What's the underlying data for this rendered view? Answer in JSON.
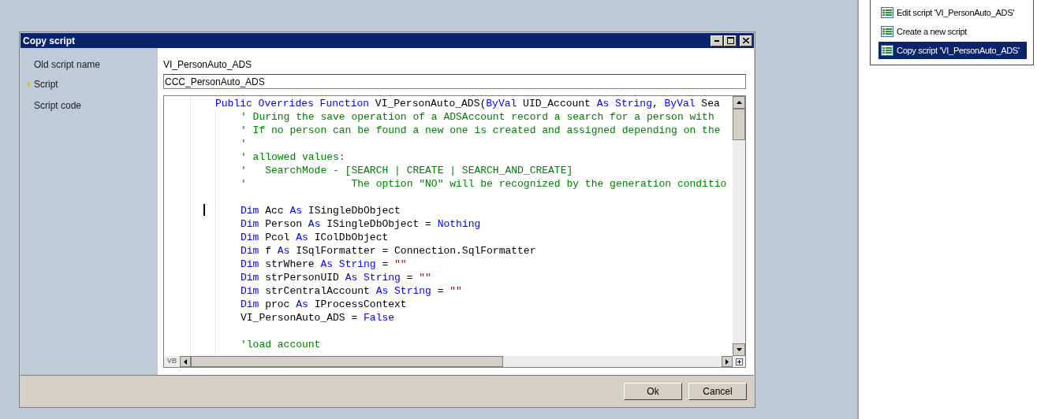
{
  "dialog": {
    "title": "Copy script",
    "fields": [
      {
        "label": "Old script name",
        "selected": false,
        "kind": "text",
        "value": "VI_PersonAuto_ADS"
      },
      {
        "label": "Script",
        "selected": true,
        "kind": "input",
        "value": "CCC_PersonAuto_ADS"
      },
      {
        "label": "Script code",
        "selected": false,
        "kind": "code"
      }
    ],
    "code": {
      "language": "VB",
      "lines": [
        {
          "kind": "signature",
          "tokens": [
            {
              "text": "Public Overrides Function",
              "kind": "keyword"
            },
            {
              "text": " VI_PersonAuto_ADS(",
              "kind": "plain"
            },
            {
              "text": "ByVal",
              "kind": "keyword"
            },
            {
              "text": " UID_Account ",
              "kind": "plain"
            },
            {
              "text": "As String",
              "kind": "keyword"
            },
            {
              "text": ", ",
              "kind": "plain"
            },
            {
              "text": "ByVal",
              "kind": "keyword"
            },
            {
              "text": " Sea",
              "kind": "plain"
            }
          ]
        },
        {
          "kind": "body",
          "tokens": [
            {
              "text": "' During the save operation of a ADSAccount record a search for a person with",
              "kind": "comment"
            }
          ]
        },
        {
          "kind": "body",
          "tokens": [
            {
              "text": "' If no person can be found a new one is created and assigned depending on the",
              "kind": "comment"
            }
          ]
        },
        {
          "kind": "body",
          "tokens": [
            {
              "text": "'",
              "kind": "comment"
            }
          ]
        },
        {
          "kind": "body",
          "tokens": [
            {
              "text": "' allowed values:",
              "kind": "comment"
            }
          ]
        },
        {
          "kind": "body",
          "tokens": [
            {
              "text": "'   SearchMode - [SEARCH | CREATE | SEARCH_AND_CREATE]",
              "kind": "comment"
            }
          ]
        },
        {
          "kind": "body",
          "tokens": [
            {
              "text": "'                 The option \"NO\" will be recognized by the generation conditio",
              "kind": "comment"
            }
          ]
        },
        {
          "kind": "blank"
        },
        {
          "kind": "body",
          "tokens": [
            {
              "text": "Dim",
              "kind": "keyword"
            },
            {
              "text": " Acc ",
              "kind": "plain"
            },
            {
              "text": "As",
              "kind": "keyword"
            },
            {
              "text": " ISingleDbObject",
              "kind": "plain"
            }
          ]
        },
        {
          "kind": "body",
          "tokens": [
            {
              "text": "Dim",
              "kind": "keyword"
            },
            {
              "text": " Person ",
              "kind": "plain"
            },
            {
              "text": "As",
              "kind": "keyword"
            },
            {
              "text": " ISingleDbObject = ",
              "kind": "plain"
            },
            {
              "text": "Nothing",
              "kind": "keyword"
            }
          ]
        },
        {
          "kind": "body",
          "tokens": [
            {
              "text": "Dim",
              "kind": "keyword"
            },
            {
              "text": " Pcol ",
              "kind": "plain"
            },
            {
              "text": "As",
              "kind": "keyword"
            },
            {
              "text": " IColDbObject",
              "kind": "plain"
            }
          ]
        },
        {
          "kind": "body",
          "tokens": [
            {
              "text": "Dim",
              "kind": "keyword"
            },
            {
              "text": " f ",
              "kind": "plain"
            },
            {
              "text": "As",
              "kind": "keyword"
            },
            {
              "text": " ISqlFormatter = Connection.SqlFormatter",
              "kind": "plain"
            }
          ]
        },
        {
          "kind": "body",
          "tokens": [
            {
              "text": "Dim",
              "kind": "keyword"
            },
            {
              "text": " strWhere ",
              "kind": "plain"
            },
            {
              "text": "As String",
              "kind": "keyword"
            },
            {
              "text": " = ",
              "kind": "plain"
            },
            {
              "text": "\"\"",
              "kind": "string"
            }
          ]
        },
        {
          "kind": "body",
          "tokens": [
            {
              "text": "Dim",
              "kind": "keyword"
            },
            {
              "text": " strPersonUID ",
              "kind": "plain"
            },
            {
              "text": "As String",
              "kind": "keyword"
            },
            {
              "text": " = ",
              "kind": "plain"
            },
            {
              "text": "\"\"",
              "kind": "string"
            }
          ]
        },
        {
          "kind": "body",
          "tokens": [
            {
              "text": "Dim",
              "kind": "keyword"
            },
            {
              "text": " strCentralAccount ",
              "kind": "plain"
            },
            {
              "text": "As String",
              "kind": "keyword"
            },
            {
              "text": " = ",
              "kind": "plain"
            },
            {
              "text": "\"\"",
              "kind": "string"
            }
          ]
        },
        {
          "kind": "body",
          "tokens": [
            {
              "text": "Dim",
              "kind": "keyword"
            },
            {
              "text": " proc ",
              "kind": "plain"
            },
            {
              "text": "As",
              "kind": "keyword"
            },
            {
              "text": " IProcessContext",
              "kind": "plain"
            }
          ]
        },
        {
          "kind": "body",
          "tokens": [
            {
              "text": "VI_PersonAuto_ADS = ",
              "kind": "plain"
            },
            {
              "text": "False",
              "kind": "keyword"
            }
          ]
        },
        {
          "kind": "blank"
        },
        {
          "kind": "body",
          "tokens": [
            {
              "text": "'load account",
              "kind": "comment"
            }
          ]
        }
      ]
    },
    "buttons": [
      "Ok",
      "Cancel"
    ]
  },
  "menu": {
    "items": [
      {
        "label": "Edit script 'VI_PersonAuto_ADS'",
        "selected": false
      },
      {
        "label": "Create a new script",
        "selected": false
      },
      {
        "label": "Copy script 'VI_PersonAuto_ADS'",
        "selected": true
      }
    ]
  }
}
